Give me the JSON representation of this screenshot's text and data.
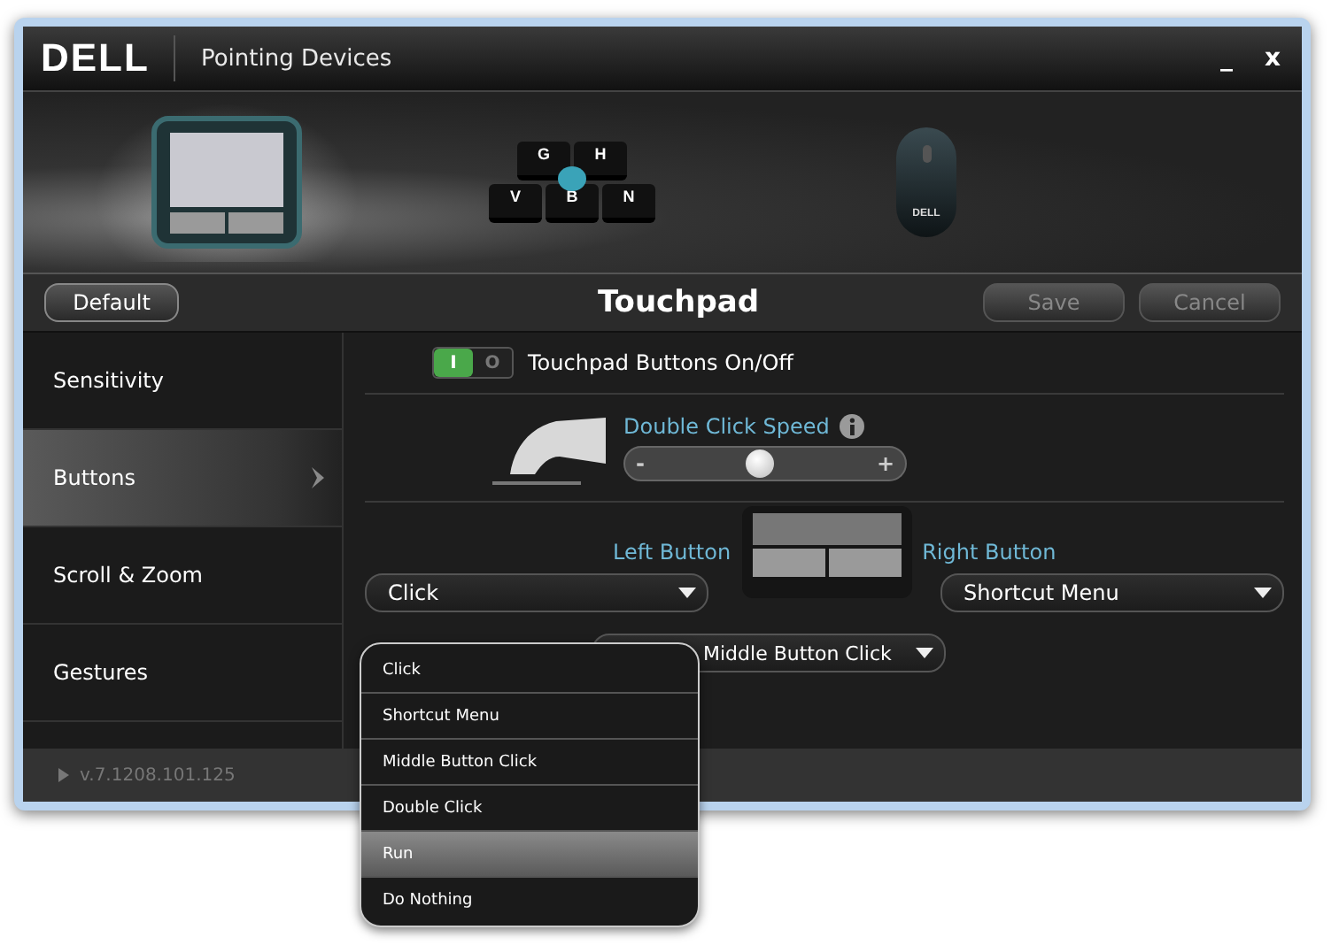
{
  "window": {
    "logo": "DELL",
    "title": "Pointing Devices",
    "minimize": "_",
    "close": "x"
  },
  "devices": [
    {
      "kind": "touchpad",
      "selected": true
    },
    {
      "kind": "pointing-stick",
      "selected": false,
      "keys": [
        "G",
        "H",
        "V",
        "B",
        "N"
      ]
    },
    {
      "kind": "mouse",
      "selected": false,
      "logo": "DELL"
    }
  ],
  "toolbar": {
    "default_button": "Default",
    "title": "Touchpad",
    "buttons": [
      {
        "label": "Save",
        "disabled": true
      },
      {
        "label": "Cancel",
        "disabled": true
      }
    ]
  },
  "sidebar": {
    "items": [
      {
        "label": "Sensitivity",
        "selected": false
      },
      {
        "label": "Buttons",
        "selected": true
      },
      {
        "label": "Scroll & Zoom",
        "selected": false
      },
      {
        "label": "Gestures",
        "selected": false
      }
    ],
    "version": "v.7.1208.101.125"
  },
  "toggle": {
    "label": "Touchpad Buttons On/Off",
    "on": true,
    "on_text": "I",
    "off_text": "O"
  },
  "double_click": {
    "label": "Double Click Speed",
    "minus": "-",
    "plus": "+",
    "level": 0.5
  },
  "buttons": {
    "left_label": "Left Button",
    "right_label": "Right Button",
    "left_value": "Click",
    "right_value": "Shortcut Menu",
    "both_value": "Middle Button Click"
  },
  "menu": {
    "items": [
      {
        "label": "Click",
        "selected": false
      },
      {
        "label": "Shortcut Menu",
        "selected": false
      },
      {
        "label": "Middle Button Click",
        "selected": false
      },
      {
        "label": "Double Click",
        "selected": false
      },
      {
        "label": "Run",
        "selected": true
      },
      {
        "label": "Do Nothing",
        "selected": false
      }
    ]
  }
}
